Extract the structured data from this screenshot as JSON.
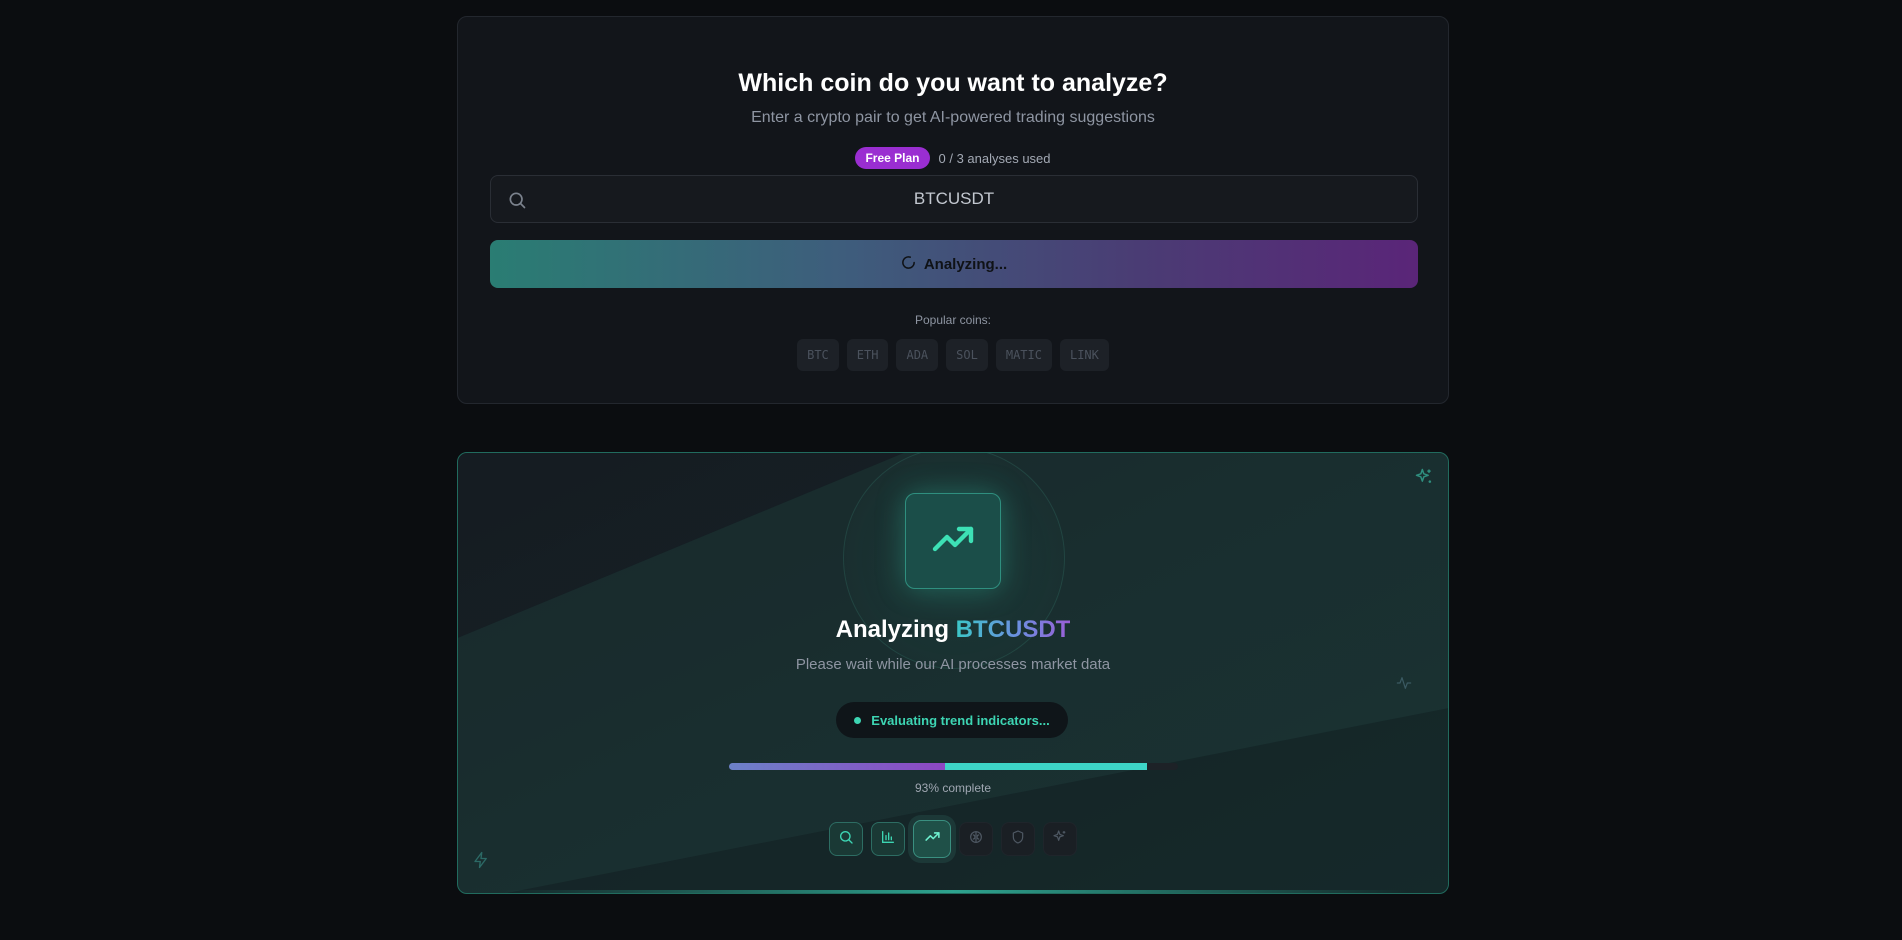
{
  "search_card": {
    "title": "Which coin do you want to analyze?",
    "subtitle": "Enter a crypto pair to get AI-powered trading suggestions",
    "plan_badge": "Free Plan",
    "usage": "0 / 3 analyses used",
    "search_value": "BTCUSDT",
    "search_icon": "search-icon",
    "analyze_button_label": "Analyzing...",
    "popular_label": "Popular coins:",
    "popular_coins": [
      "BTC",
      "ETH",
      "ADA",
      "SOL",
      "MATIC",
      "LINK"
    ]
  },
  "analysis_card": {
    "title_prefix": "Analyzing",
    "coin": "BTCUSDT",
    "wait_text": "Please wait while our AI processes market data",
    "status": "Evaluating trend indicators...",
    "progress_percent": 93,
    "progress_label": "93% complete",
    "steps": [
      {
        "icon": "search-icon",
        "state": "done"
      },
      {
        "icon": "bar-chart-icon",
        "state": "done"
      },
      {
        "icon": "trending-up-icon",
        "state": "active"
      },
      {
        "icon": "brain-icon",
        "state": "pending"
      },
      {
        "icon": "shield-icon",
        "state": "pending"
      },
      {
        "icon": "sparkles-icon",
        "state": "pending"
      }
    ]
  },
  "colors": {
    "accent_teal": "#3dd5b3",
    "accent_purple": "#9a2ed1",
    "background": "#0b0d10"
  }
}
